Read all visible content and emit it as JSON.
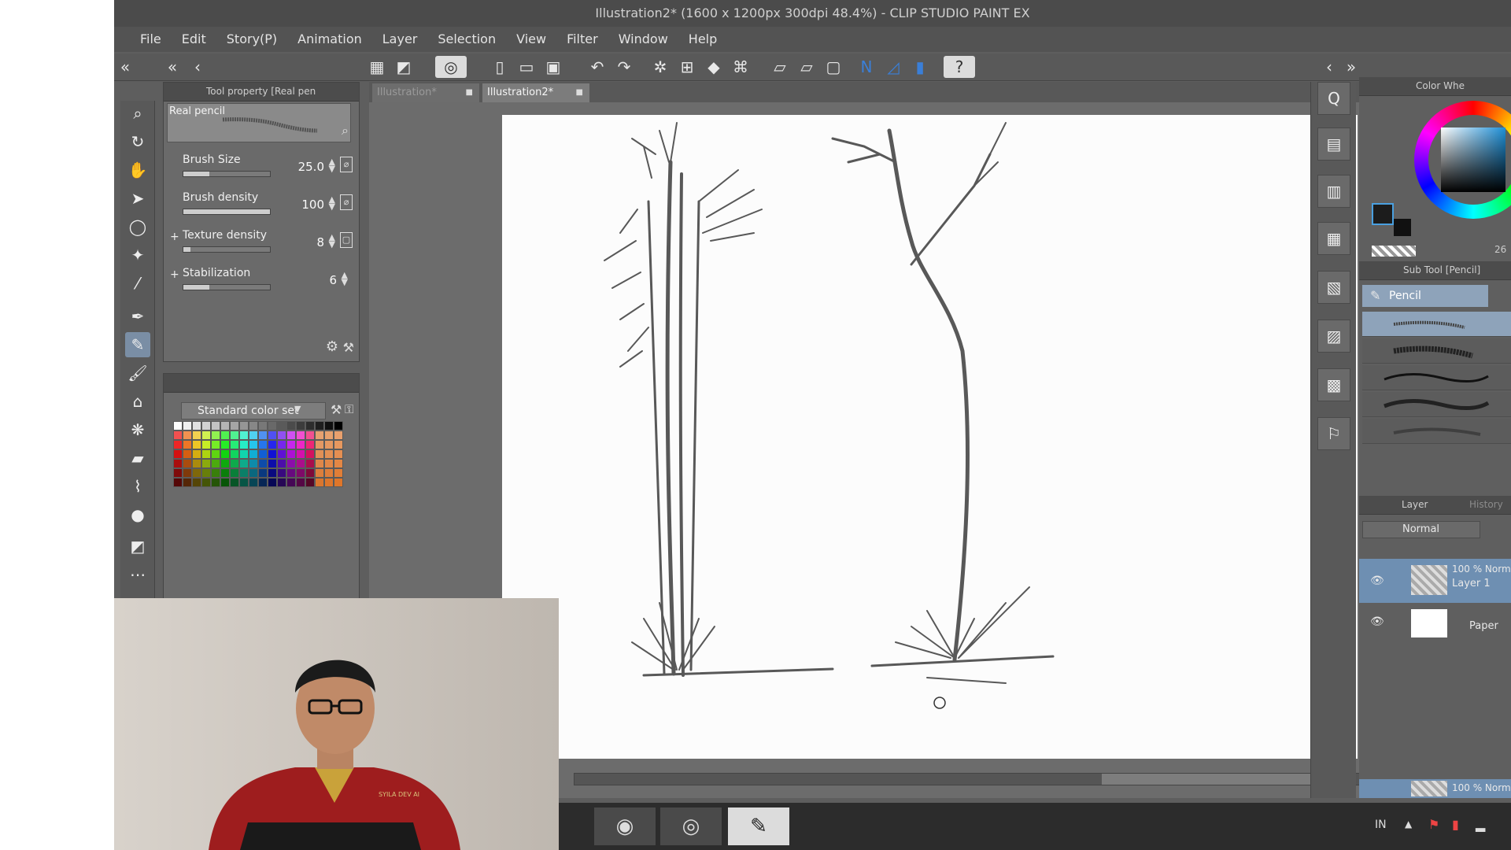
{
  "window": {
    "title": "Illustration2* (1600 x 1200px 300dpi 48.4%) - CLIP STUDIO PAINT EX"
  },
  "menu": [
    "File",
    "Edit",
    "Story(P)",
    "Animation",
    "Layer",
    "Selection",
    "View",
    "Filter",
    "Window",
    "Help"
  ],
  "tool_property": {
    "header": "Tool property [Real pen",
    "brush_name": "Real pencil",
    "rows": [
      {
        "label": "Brush Size",
        "value": "25.0",
        "fill": 0.3
      },
      {
        "label": "Brush density",
        "value": "100",
        "fill": 1.0
      },
      {
        "label": "Texture density",
        "value": "8",
        "fill": 0.08
      },
      {
        "label": "Stabilization",
        "value": "6",
        "fill": 0.3
      }
    ]
  },
  "color_set": {
    "selected": "Standard color set"
  },
  "document_tabs": [
    {
      "label": "Illustration*",
      "active": false
    },
    {
      "label": "Illustration2*",
      "active": true
    }
  ],
  "color_wheel": {
    "title": "Color Whe",
    "readout": "26",
    "main_color": "#1c1c1c"
  },
  "sub_tool": {
    "header": "Sub Tool [Pencil]",
    "selected": "Pencil"
  },
  "layer_panel": {
    "tab_layer": "Layer",
    "tab_history": "History",
    "blend_mode": "Normal",
    "layers": [
      {
        "line1": "100 % Norm",
        "line2": "Layer 1"
      },
      {
        "line1": "",
        "line2": "Paper"
      }
    ],
    "bottom_layer": "100 % Norm"
  },
  "taskbar": {
    "lang": "IN"
  },
  "webcam": {
    "shirt_text": "SYILA DEV AI"
  },
  "colors": {
    "accent": "#3a7fd8",
    "selection": "#8ea3ba",
    "shirt": "#9e1d1e"
  }
}
